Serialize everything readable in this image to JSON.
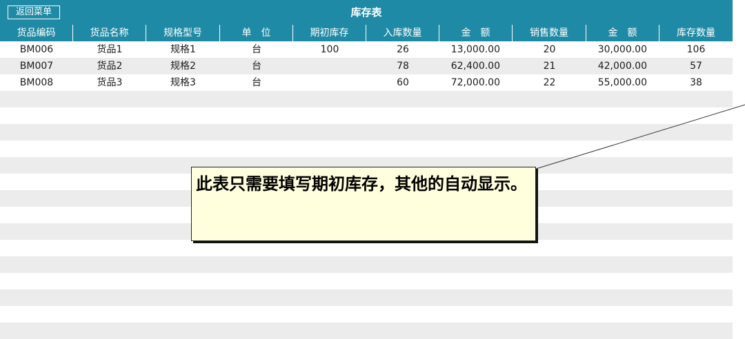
{
  "toolbar": {
    "back_label": "返回菜单"
  },
  "sheet": {
    "title": "库存表"
  },
  "columns": [
    "货品编码",
    "货品名称",
    "规格型号",
    "单　位",
    "期初库存",
    "入库数量",
    "金　额",
    "销售数量",
    "金　额",
    "库存数量"
  ],
  "rows": [
    [
      "BM006",
      "货品1",
      "规格1",
      "台",
      "100",
      "26",
      "13,000.00",
      "20",
      "30,000.00",
      "106"
    ],
    [
      "BM007",
      "货品2",
      "规格2",
      "台",
      "",
      "78",
      "62,400.00",
      "21",
      "42,000.00",
      "57"
    ],
    [
      "BM008",
      "货品3",
      "规格3",
      "台",
      "",
      "60",
      "72,000.00",
      "22",
      "55,000.00",
      "38"
    ]
  ],
  "note": {
    "text": "此表只需要填写期初库存，其他的自动显示。"
  },
  "colors": {
    "header_bg": "#1f8aa5",
    "stripe": "#ececec",
    "note_bg": "#ffffdd"
  }
}
